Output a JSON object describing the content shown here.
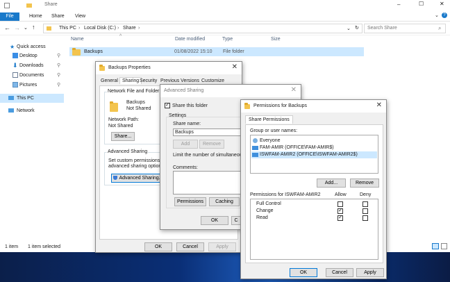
{
  "window": {
    "title": "Share",
    "controls": {
      "minimize": "–",
      "maximize": "☐",
      "close": "✕"
    }
  },
  "ribbon": {
    "tabs": [
      "File",
      "Home",
      "Share",
      "View"
    ]
  },
  "address": {
    "path": [
      "This PC",
      "Local Disk (C:)",
      "Share"
    ],
    "search_placeholder": "Search Share"
  },
  "nav": {
    "items": [
      {
        "label": "Quick access"
      },
      {
        "label": "Desktop"
      },
      {
        "label": "Downloads"
      },
      {
        "label": "Documents"
      },
      {
        "label": "Pictures"
      },
      {
        "label": "This PC"
      },
      {
        "label": "Network"
      }
    ]
  },
  "list": {
    "columns": [
      "Name",
      "Date modified",
      "Type",
      "Size"
    ],
    "rows": [
      {
        "name": "Backups",
        "date": "01/08/2022 15:10",
        "type": "File folder",
        "size": ""
      }
    ]
  },
  "status": {
    "count": "1 item",
    "selected": "1 item selected"
  },
  "properties": {
    "title": "Backups Properties",
    "tabs": [
      "General",
      "Sharing",
      "Security",
      "Previous Versions",
      "Customize"
    ],
    "section1": "Network File and Folder Sh",
    "folder_name": "Backups",
    "folder_state": "Not Shared",
    "netpath_label": "Network Path:",
    "netpath_value": "Not Shared",
    "share_btn": "Share...",
    "section2": "Advanced Sharing",
    "desc1": "Set custom permissions, cre",
    "desc2": "advanced sharing options.",
    "adv_btn": "Advanced Sharing...",
    "ok": "OK",
    "cancel": "Cancel",
    "apply": "Apply"
  },
  "advanced": {
    "title": "Advanced Sharing",
    "share_check": "Share this folder",
    "settings": "Settings",
    "share_name_label": "Share name:",
    "share_name": "Backups",
    "add": "Add",
    "remove": "Remove",
    "limit": "Limit the number of simultaneous us",
    "comments": "Comments:",
    "permissions_btn": "Permissions",
    "caching_btn": "Caching",
    "ok": "OK",
    "cancel": "C"
  },
  "permissions": {
    "title": "Permissions for Backups",
    "tab": "Share Permissions",
    "group_label": "Group or user names:",
    "users": [
      {
        "name": "Everyone",
        "icon": "group-icon"
      },
      {
        "name": "FAM-AMIR (OFFICE\\FAM-AMIR$)",
        "icon": "computer-icon"
      },
      {
        "name": "ISWFAM-AMIR2 (OFFICE\\ISWFAM-AMIR2$)",
        "icon": "computer-icon"
      }
    ],
    "add_btn": "Add...",
    "remove_btn": "Remove",
    "perm_label": "Permissions for ISWFAM-AMIR2",
    "allow": "Allow",
    "deny": "Deny",
    "rows": [
      {
        "name": "Full Control",
        "allow": false,
        "deny": false
      },
      {
        "name": "Change",
        "allow": true,
        "deny": false
      },
      {
        "name": "Read",
        "allow": true,
        "deny": false
      }
    ],
    "ok": "OK",
    "cancel": "Cancel",
    "apply": "Apply"
  }
}
